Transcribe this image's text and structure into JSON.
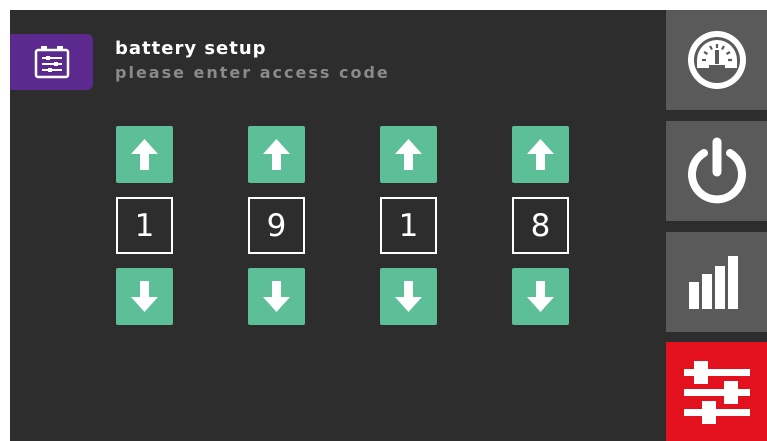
{
  "header": {
    "icon": "battery-settings-icon",
    "title": "battery setup",
    "subtitle": "please enter access code"
  },
  "access_code": {
    "digits": [
      "1",
      "9",
      "1",
      "8"
    ],
    "up_icon": "arrow-up-icon",
    "down_icon": "arrow-down-icon"
  },
  "sidebar": {
    "items": [
      {
        "icon": "gauge-icon",
        "active": false
      },
      {
        "icon": "power-icon",
        "active": false
      },
      {
        "icon": "bar-chart-icon",
        "active": false
      },
      {
        "icon": "settings-sliders-icon",
        "active": true
      }
    ]
  },
  "colors": {
    "background": "#2d2d2d",
    "header_icon_bg": "#5c2a8e",
    "arrow_button": "#5cbf98",
    "sidebar_button": "#5a5a5a",
    "active_button": "#e3101e",
    "subtitle_text": "#8a8a8a"
  }
}
